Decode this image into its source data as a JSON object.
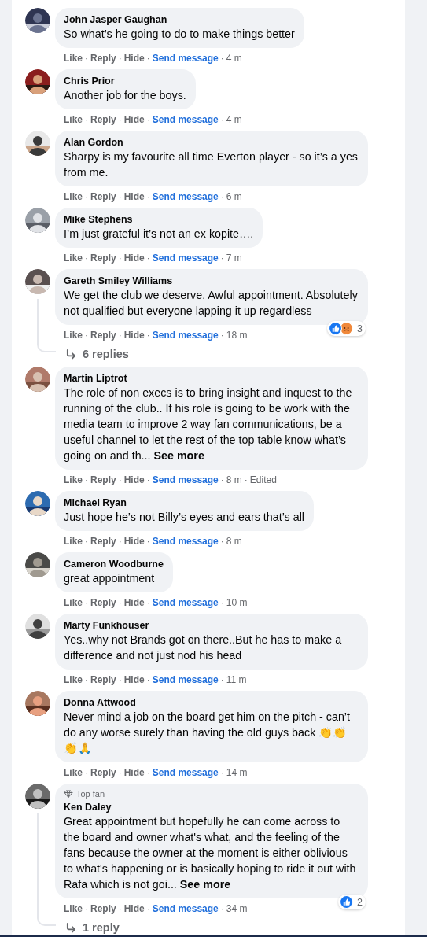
{
  "separator": "·",
  "comments": [
    {
      "author": "John Jasper Gaughan",
      "text": "So what’s he going to do to make things better",
      "actions": [
        "Like",
        "Reply",
        "Hide"
      ],
      "send_message": "Send message",
      "time": "4 m"
    },
    {
      "author": "Chris Prior",
      "text": "Another job for the boys.",
      "actions": [
        "Like",
        "Reply",
        "Hide"
      ],
      "send_message": "Send message",
      "time": "4 m"
    },
    {
      "author": "Alan Gordon",
      "text": "Sharpy is my favourite all time Everton player - so it’s a yes from me.",
      "actions": [
        "Like",
        "Reply",
        "Hide"
      ],
      "send_message": "Send message",
      "time": "6 m"
    },
    {
      "author": "Mike Stephens",
      "text": "I’m just grateful it’s not an ex kopite….",
      "actions": [
        "Like",
        "Reply",
        "Hide"
      ],
      "send_message": "Send message",
      "time": "7 m"
    },
    {
      "author": "Gareth Smiley Williams",
      "text": "We get the club we deserve. Awful appointment. Absolutely not qualified but everyone lapping it up regardless",
      "actions": [
        "Like",
        "Reply",
        "Hide"
      ],
      "send_message": "Send message",
      "time": "18 m",
      "reactions": {
        "types": [
          {
            "kind": "like"
          },
          {
            "kind": "angry"
          }
        ],
        "count": "3"
      },
      "replies": "6 replies"
    },
    {
      "author": "Martin Liptrot",
      "text": "The role of non execs is to bring insight and inquest to the running of the club.. If his role is going to be work with the media team to improve 2 way fan communications, be a useful channel to let the rest of the top table know what’s going on and th...",
      "see_more": "See more",
      "actions": [
        "Like",
        "Reply",
        "Hide"
      ],
      "send_message": "Send message",
      "time": "8 m",
      "edited": "Edited"
    },
    {
      "author": "Michael Ryan",
      "text": "Just hope he’s not Billy’s eyes and ears that’s all",
      "actions": [
        "Like",
        "Reply",
        "Hide"
      ],
      "send_message": "Send message",
      "time": "8 m"
    },
    {
      "author": "Cameron Woodburne",
      "text": "great appointment",
      "actions": [
        "Like",
        "Reply",
        "Hide"
      ],
      "send_message": "Send message",
      "time": "10 m"
    },
    {
      "author": "Marty Funkhouser",
      "text": "Yes..why not Brands got on there..But he has to make a difference and not just nod his head",
      "actions": [
        "Like",
        "Reply",
        "Hide"
      ],
      "send_message": "Send message",
      "time": "11 m"
    },
    {
      "author": "Donna Attwood",
      "text": "Never mind a job on the board get him on the pitch - can’t do any worse surely than having the old guys back 👏👏👏🙏",
      "actions": [
        "Like",
        "Reply",
        "Hide"
      ],
      "send_message": "Send message",
      "time": "14 m"
    },
    {
      "author": "Ken Daley",
      "badge": "Top fan",
      "text": "Great appointment but hopefully he can come across to the board and owner what's what, and the feeling of the fans because the owner at the moment is either oblivious to what's happening or is basically hoping to ride it out with Rafa which is not goi...",
      "see_more": "See more",
      "actions": [
        "Like",
        "Reply",
        "Hide"
      ],
      "send_message": "Send message",
      "time": "34 m",
      "reactions": {
        "types": [
          {
            "kind": "like"
          }
        ],
        "count": "2"
      },
      "replies": "1 reply"
    }
  ]
}
